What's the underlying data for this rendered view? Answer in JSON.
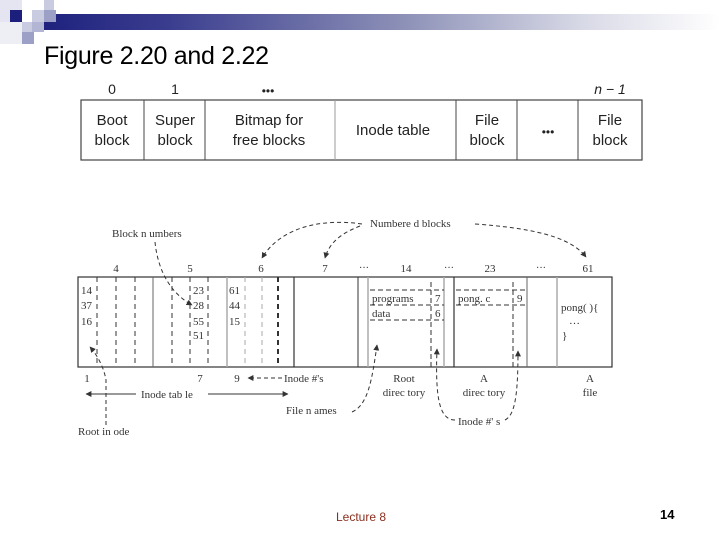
{
  "slide": {
    "title": "Figure 2.20 and 2.22",
    "footer_center": "Lecture 8",
    "page_number": "14",
    "accent_color": "#1c1f7c",
    "footer_color": "#8b2f1f"
  },
  "layout_diagram": {
    "block_labels": {
      "first": "0",
      "second": "1",
      "middle_dots": "•••",
      "last": "n − 1"
    },
    "cells": [
      {
        "line1": "Boot",
        "line2": "block"
      },
      {
        "line1": "Super",
        "line2": "block"
      },
      {
        "line1": "Bitmap for",
        "line2": "free blocks"
      },
      {
        "line1": "Inode table",
        "line2": ""
      },
      {
        "line1": "File",
        "line2": "block"
      },
      {
        "line1": "•••",
        "line2": ""
      },
      {
        "line1": "File",
        "line2": "block"
      }
    ]
  },
  "inode_diagram": {
    "annotations": {
      "block_numbers": "Block n umbers",
      "numbered_blocks": "Numbere d blocks",
      "inode_numbers_top": "Inode #'s",
      "inode_table": "Inode  tab le",
      "file_names": "File n ames",
      "root_inode": "Root in ode",
      "inode_numbers_bottom": "Inode #' s"
    },
    "top_numbers": [
      "4",
      "5",
      "6",
      "7",
      "···",
      "14",
      "···",
      "23",
      "···",
      "61"
    ],
    "inode_columns": {
      "inode1": [
        "14",
        "37",
        "16"
      ],
      "inode7": [
        "23",
        "28",
        "55",
        "51"
      ],
      "inode9": [
        "61",
        "44",
        "15"
      ]
    },
    "bottom_numbers": [
      "1",
      "7",
      "9"
    ],
    "root_directory": {
      "entries": [
        {
          "name": "programs",
          "inode": "7"
        },
        {
          "name": "data",
          "inode": "6"
        }
      ],
      "label_line1": "Root",
      "label_line2": "direc tory"
    },
    "a_directory": {
      "entries": [
        {
          "name": "pong. c",
          "inode": "9"
        }
      ],
      "label_line1": "A",
      "label_line2": "direc tory"
    },
    "a_file": {
      "content": [
        "pong( ){",
        "…",
        "}"
      ],
      "label_line1": "A",
      "label_line2": "file"
    }
  }
}
